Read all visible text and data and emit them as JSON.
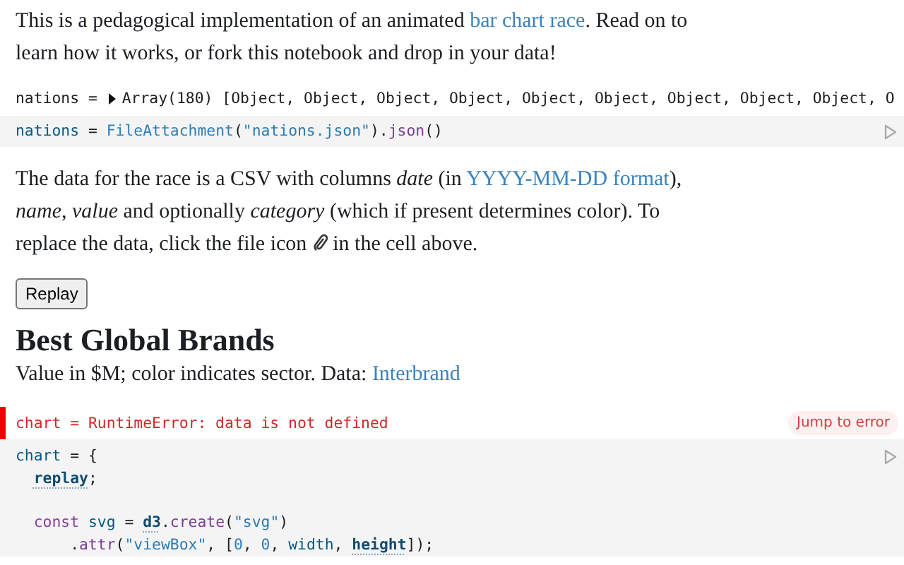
{
  "intro": [
    {
      "kind": "text",
      "text": "This is a pedagogical implementation of an animated "
    },
    {
      "kind": "link",
      "text": "bar chart race"
    },
    {
      "kind": "text",
      "text": ". Read on to learn how it works, or fork this notebook and drop in your data!"
    }
  ],
  "output": {
    "name": "nations = ",
    "value": "Array(180) [Object, Object, Object, Object, Object, Object, Object, Object, Object, O",
    "expanded": false
  },
  "cell1": {
    "lines": [
      [
        {
          "kind": "var",
          "text": "nations"
        },
        {
          "kind": "op",
          "text": " = "
        },
        {
          "kind": "fn",
          "text": "FileAttachment"
        },
        {
          "kind": "op",
          "text": "("
        },
        {
          "kind": "str",
          "text": "\"nations.json\""
        },
        {
          "kind": "op",
          "text": ")."
        },
        {
          "kind": "method",
          "text": "json"
        },
        {
          "kind": "op",
          "text": "()"
        }
      ]
    ]
  },
  "description": [
    {
      "kind": "text",
      "text": "The data for the race is a CSV with columns *date* (in "
    },
    {
      "kind": "link",
      "text": "YYYY-MM-DD format"
    },
    {
      "kind": "text",
      "text": "), *name*, *value* and optionally *category* (which if present determines color). To replace the data, click the file icon "
    },
    {
      "kind": "icon"
    },
    {
      "kind": "text",
      "text": " in the cell above."
    }
  ],
  "replay_button": "Replay",
  "title": "Best Global Brands",
  "subtitle": [
    {
      "kind": "text",
      "text": "Value in $M; color indicates sector. Data: "
    },
    {
      "kind": "link",
      "text": "Interbrand"
    }
  ],
  "error": {
    "text": "chart = RuntimeError: data is not defined",
    "action": "Jump to error"
  },
  "cell2": {
    "lines": [
      [
        {
          "kind": "var",
          "text": "chart"
        },
        {
          "kind": "op",
          "text": " = {"
        }
      ],
      [
        {
          "kind": "ref",
          "text": "  replay"
        },
        {
          "kind": "op",
          "text": ";"
        }
      ],
      [
        {
          "kind": "kw",
          "text": "  const"
        },
        {
          "kind": "var",
          "text": " svg"
        },
        {
          "kind": "op",
          "text": " = "
        },
        {
          "kind": "ref",
          "text": "d3"
        },
        {
          "kind": "op",
          "text": "."
        },
        {
          "kind": "method",
          "text": "create"
        },
        {
          "kind": "op",
          "text": "("
        },
        {
          "kind": "str",
          "text": "\"svg\""
        },
        {
          "kind": "op",
          "text": ")"
        }
      ],
      [
        {
          "kind": "op",
          "text": "      ."
        },
        {
          "kind": "method",
          "text": "attr"
        },
        {
          "kind": "op",
          "text": "("
        },
        {
          "kind": "str",
          "text": "\"viewBox\""
        },
        {
          "kind": "op",
          "text": ", ["
        },
        {
          "kind": "num",
          "text": "0"
        },
        {
          "kind": "op",
          "text": ", "
        },
        {
          "kind": "num",
          "text": "0"
        },
        {
          "kind": "op",
          "text": ", "
        },
        {
          "kind": "var",
          "text": "width"
        },
        {
          "kind": "op",
          "text": ", "
        },
        {
          "kind": "ref",
          "text": "height"
        },
        {
          "kind": "op",
          "text": "]);"
        }
      ]
    ]
  }
}
